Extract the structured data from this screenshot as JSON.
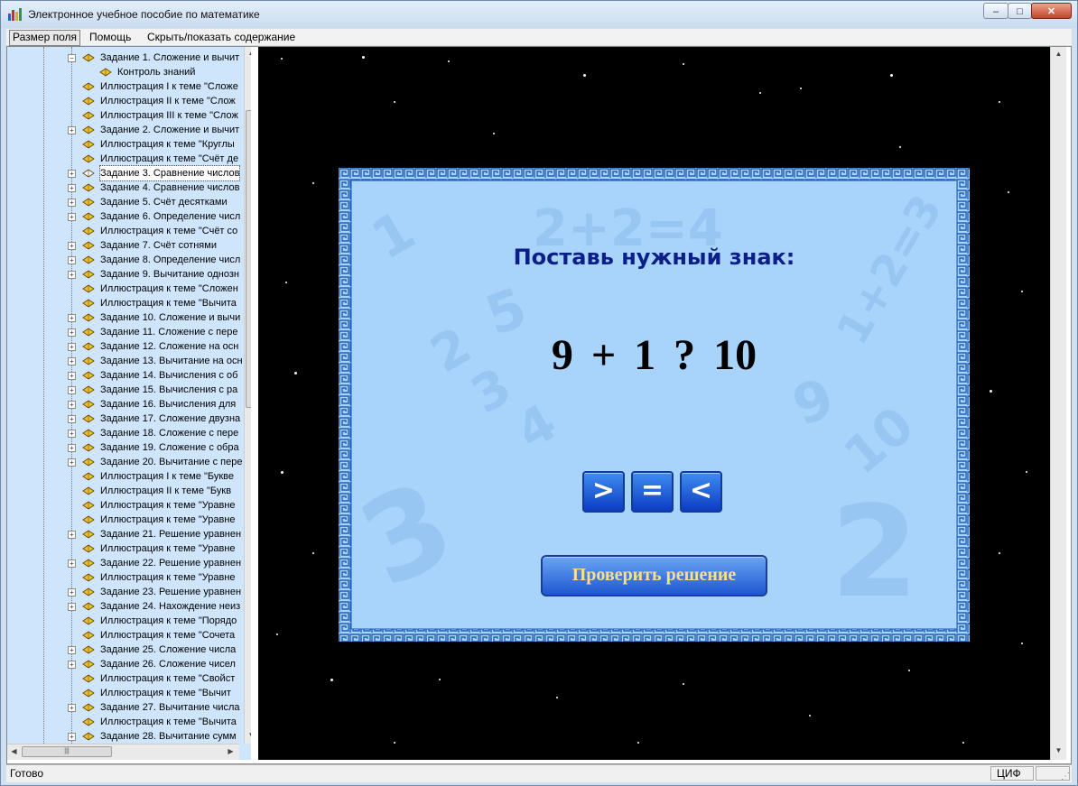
{
  "window": {
    "title": "Электронное учебное пособие по математике",
    "minimize": "–",
    "maximize": "□",
    "close": "✕"
  },
  "menu": {
    "items": [
      "Размер поля",
      "Помощь",
      "Скрыть/показать содержание"
    ]
  },
  "tree": {
    "items": [
      {
        "label": "Задание 1. Сложение и вычит",
        "expander": "−",
        "level": 0
      },
      {
        "label": "Контроль знаний",
        "expander": "",
        "level": 1
      },
      {
        "label": "Иллюстрация I к теме \"Сложе",
        "expander": "",
        "level": 0
      },
      {
        "label": "Иллюстрация II к теме \"Слож",
        "expander": "",
        "level": 0
      },
      {
        "label": "Иллюстрация III к теме \"Слож",
        "expander": "",
        "level": 0
      },
      {
        "label": "Задание 2. Сложение и вычит",
        "expander": "+",
        "level": 0
      },
      {
        "label": "Иллюстрация к теме \"Круглы",
        "expander": "",
        "level": 0
      },
      {
        "label": "Иллюстрация к теме \"Счёт де",
        "expander": "",
        "level": 0
      },
      {
        "label": "Задание 3. Сравнение числов",
        "expander": "+",
        "level": 0,
        "selected": true
      },
      {
        "label": "Задание 4. Сравнение числов",
        "expander": "+",
        "level": 0
      },
      {
        "label": "Задание 5. Счёт десятками",
        "expander": "+",
        "level": 0
      },
      {
        "label": "Задание 6. Определение числ",
        "expander": "+",
        "level": 0
      },
      {
        "label": "Иллюстрация к теме \"Счёт со",
        "expander": "",
        "level": 0
      },
      {
        "label": "Задание 7. Счёт сотнями",
        "expander": "+",
        "level": 0
      },
      {
        "label": "Задание 8. Определение числ",
        "expander": "+",
        "level": 0
      },
      {
        "label": "Задание 9. Вычитание однозн",
        "expander": "+",
        "level": 0
      },
      {
        "label": "Иллюстрация к теме \"Сложен",
        "expander": "",
        "level": 0
      },
      {
        "label": "Иллюстрация к теме \"Вычита",
        "expander": "",
        "level": 0
      },
      {
        "label": "Задание 10. Сложение и вычи",
        "expander": "+",
        "level": 0
      },
      {
        "label": "Задание 11. Сложение с пере",
        "expander": "+",
        "level": 0
      },
      {
        "label": "Задание 12. Сложение на осн",
        "expander": "+",
        "level": 0
      },
      {
        "label": "Задание 13. Вычитание на осн",
        "expander": "+",
        "level": 0
      },
      {
        "label": "Задание 14. Вычисления с об",
        "expander": "+",
        "level": 0
      },
      {
        "label": "Задание 15. Вычисления с ра",
        "expander": "+",
        "level": 0
      },
      {
        "label": "Задание 16. Вычисления для",
        "expander": "+",
        "level": 0
      },
      {
        "label": "Задание 17. Сложение двузна",
        "expander": "+",
        "level": 0
      },
      {
        "label": "Задание 18. Сложение с пере",
        "expander": "+",
        "level": 0
      },
      {
        "label": "Задание 19. Сложение с обра",
        "expander": "+",
        "level": 0
      },
      {
        "label": "Задание 20. Вычитание с пере",
        "expander": "+",
        "level": 0
      },
      {
        "label": "Иллюстрация I к теме \"Букве",
        "expander": "",
        "level": 0
      },
      {
        "label": "Иллюстрация II к теме \"Букв",
        "expander": "",
        "level": 0
      },
      {
        "label": "Иллюстрация к теме \"Уравне",
        "expander": "",
        "level": 0
      },
      {
        "label": "Иллюстрация к теме \"Уравне",
        "expander": "",
        "level": 0
      },
      {
        "label": "Задание 21. Решение уравнен",
        "expander": "+",
        "level": 0
      },
      {
        "label": "Иллюстрация к теме \"Уравне",
        "expander": "",
        "level": 0
      },
      {
        "label": "Задание 22. Решение уравнен",
        "expander": "+",
        "level": 0
      },
      {
        "label": "Иллюстрация к теме \"Уравне",
        "expander": "",
        "level": 0
      },
      {
        "label": "Задание 23. Решение уравнен",
        "expander": "+",
        "level": 0
      },
      {
        "label": "Задание 24. Нахождение неиз",
        "expander": "+",
        "level": 0
      },
      {
        "label": "Иллюстрация к теме \"Порядо",
        "expander": "",
        "level": 0
      },
      {
        "label": "Иллюстрация к теме \"Сочета",
        "expander": "",
        "level": 0
      },
      {
        "label": "Задание 25. Сложение числа",
        "expander": "+",
        "level": 0
      },
      {
        "label": "Задание 26. Сложение чисел",
        "expander": "+",
        "level": 0
      },
      {
        "label": "Иллюстрация к теме \"Свойст",
        "expander": "",
        "level": 0
      },
      {
        "label": "Иллюстрация к теме \"Вычит",
        "expander": "",
        "level": 0
      },
      {
        "label": "Задание 27. Вычитание числа",
        "expander": "+",
        "level": 0
      },
      {
        "label": "Иллюстрация к теме \"Вычита",
        "expander": "",
        "level": 0
      },
      {
        "label": "Задание 28. Вычитание сумм",
        "expander": "+",
        "level": 0
      }
    ]
  },
  "exercise": {
    "heading": "Поставь нужный знак:",
    "expression": "9 + 1 ? 10",
    "buttons": [
      ">",
      "=",
      "<"
    ],
    "check_label": "Проверить решение",
    "bg_numbers": [
      "1",
      "2+2=4",
      "1+2=3",
      "5",
      "4",
      "3",
      "2",
      "9",
      "10",
      "3",
      "2"
    ]
  },
  "status": {
    "text": "Готово",
    "indicator": "ЦИФ"
  },
  "colors": {
    "panel": "#a8d3fa",
    "heading": "#0c1f88",
    "button": "#1e57d0",
    "tree_bg": "#cfe5fb"
  }
}
